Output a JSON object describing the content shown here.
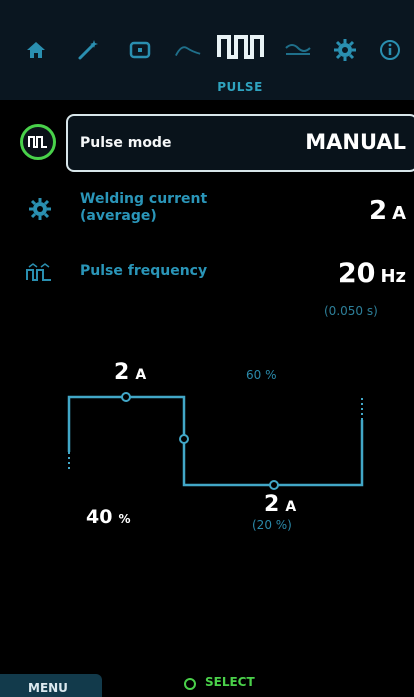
{
  "top_nav": {
    "icons": [
      {
        "name": "home-icon"
      },
      {
        "name": "wand-icon"
      },
      {
        "name": "electrode-icon"
      },
      {
        "name": "arc-wave-icon"
      },
      {
        "name": "pulse-icon",
        "active": true
      },
      {
        "name": "ac-wave-icon"
      },
      {
        "name": "gear-icon"
      },
      {
        "name": "info-icon"
      }
    ],
    "active_label": "PULSE"
  },
  "rows": {
    "pulse_mode": {
      "label": "Pulse mode",
      "value": "MANUAL",
      "icon": "pulse-mode-icon"
    },
    "welding_current": {
      "label_line1": "Welding current",
      "label_line2": "(average)",
      "value": "2",
      "unit": "A",
      "icon": "gear-icon"
    },
    "pulse_frequency": {
      "label": "Pulse frequency",
      "value": "20",
      "unit": "Hz",
      "subvalue": "(0.050 s)",
      "icon": "pulse-frequency-icon"
    }
  },
  "chart": {
    "peak_current": "2",
    "peak_unit": "A",
    "duty_percent": "60 %",
    "background_percent": "40",
    "background_percent_unit": "%",
    "base_current": "2",
    "base_unit": "A",
    "base_sub": "(20 %)"
  },
  "bottom": {
    "menu_label": "MENU",
    "select_label": "SELECT"
  },
  "colors": {
    "accent_blue": "#2a95b8",
    "selected_green": "#49d14a",
    "waveform": "#42a7c7"
  }
}
